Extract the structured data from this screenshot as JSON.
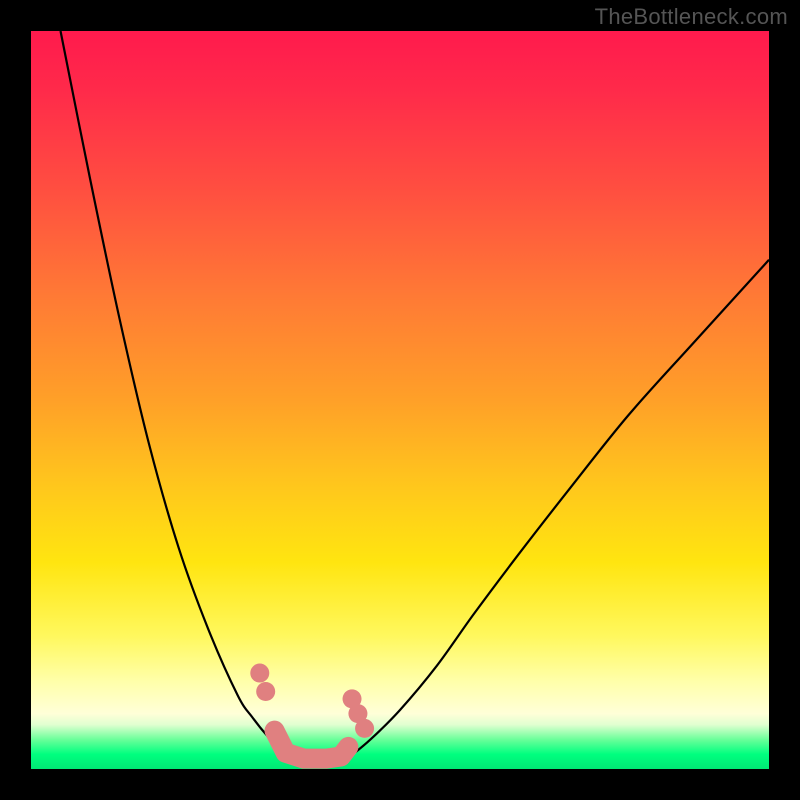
{
  "watermark": "TheBottleneck.com",
  "colors": {
    "frame": "#000000",
    "gradient_top": "#ff1a4d",
    "gradient_mid1": "#ff7a35",
    "gradient_mid2": "#ffe510",
    "gradient_pale": "#ffffd8",
    "gradient_green": "#00ff7f",
    "curve": "#000000",
    "marker": "#e08080"
  },
  "chart_data": {
    "type": "line",
    "title": "",
    "xlabel": "",
    "ylabel": "",
    "xlim": [
      0,
      100
    ],
    "ylim": [
      0,
      100
    ],
    "series": [
      {
        "name": "left-curve",
        "x": [
          4,
          8,
          12,
          16,
          20,
          24,
          28,
          30,
          32,
          34,
          35.5
        ],
        "y": [
          100,
          80,
          61,
          44,
          30,
          19,
          10,
          7,
          4.5,
          2.5,
          1.5
        ]
      },
      {
        "name": "right-curve",
        "x": [
          43,
          46,
          50,
          55,
          60,
          66,
          73,
          81,
          90,
          100
        ],
        "y": [
          1.5,
          4,
          8,
          14,
          21,
          29,
          38,
          48,
          58,
          69
        ]
      }
    ],
    "markers": [
      {
        "x": 31,
        "y": 13
      },
      {
        "x": 31.8,
        "y": 10.5
      },
      {
        "x": 43.5,
        "y": 9.5
      },
      {
        "x": 44.3,
        "y": 7.5
      },
      {
        "x": 45.2,
        "y": 5.5
      }
    ],
    "trough_path": [
      {
        "x": 33,
        "y": 5.2
      },
      {
        "x": 34.5,
        "y": 2.2
      },
      {
        "x": 37,
        "y": 1.4
      },
      {
        "x": 40,
        "y": 1.4
      },
      {
        "x": 42,
        "y": 1.7
      },
      {
        "x": 43,
        "y": 3.0
      }
    ]
  }
}
